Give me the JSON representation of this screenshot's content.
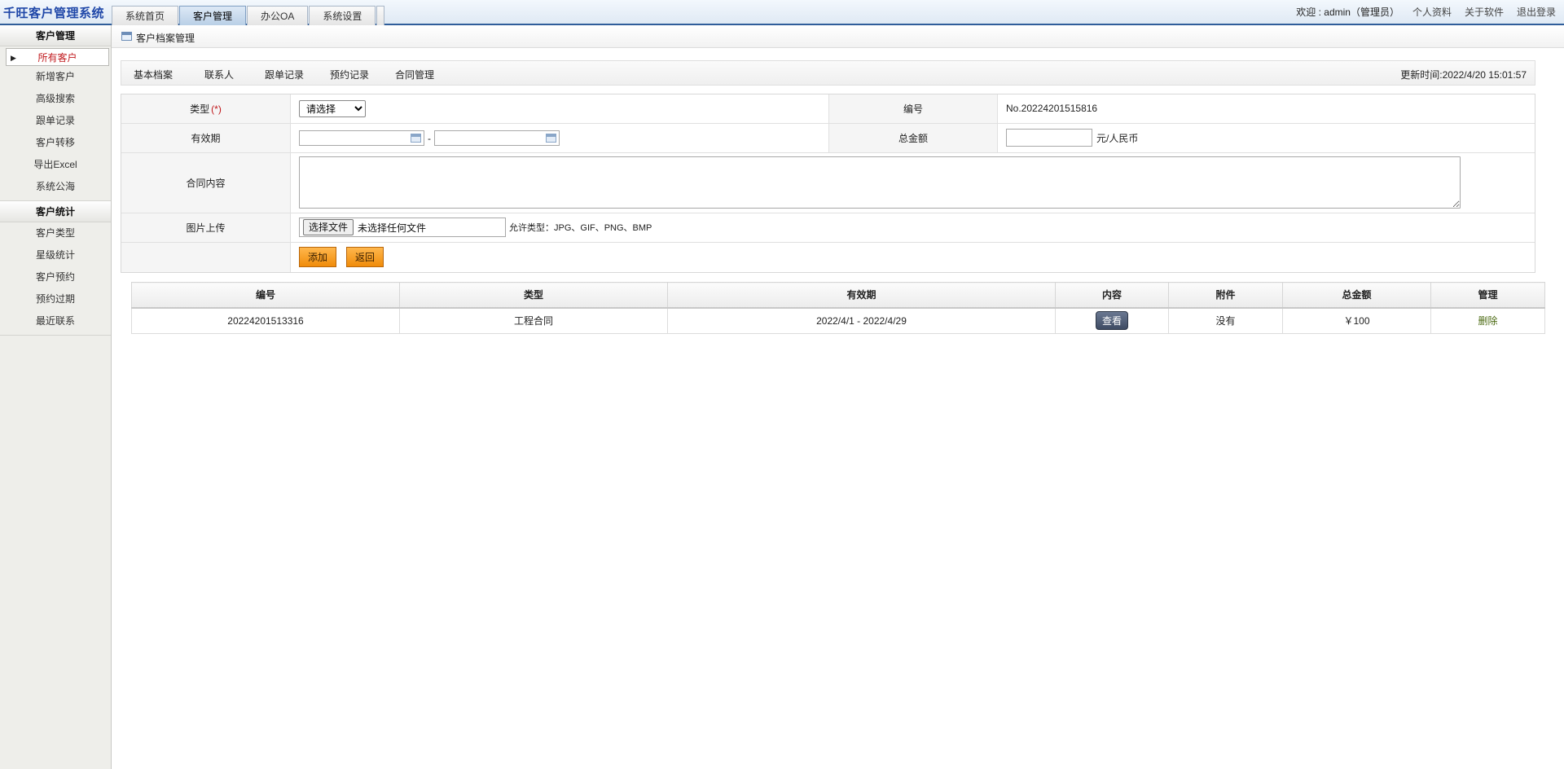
{
  "app": {
    "title": "千旺客户管理系统"
  },
  "nav_tabs": [
    "系统首页",
    "客户管理",
    "办公OA",
    "系统设置"
  ],
  "user": {
    "welcome": "欢迎 : admin（管理员）",
    "links": [
      "个人资料",
      "关于软件",
      "退出登录"
    ]
  },
  "sidebar": {
    "groups": [
      {
        "title": "客户管理",
        "items": [
          "所有客户",
          "新增客户",
          "高级搜索",
          "跟单记录",
          "客户转移",
          "导出Excel",
          "系统公海"
        ]
      },
      {
        "title": "客户统计",
        "items": [
          "客户类型",
          "星级统计",
          "客户预约",
          "预约过期",
          "最近联系"
        ]
      }
    ]
  },
  "page": {
    "title": "客户档案管理"
  },
  "subtabs": [
    "基本档案",
    "联系人",
    "跟单记录",
    "预约记录",
    "合同管理"
  ],
  "update_time": "更新时间:2022/4/20 15:01:57",
  "form": {
    "type_label": "类型",
    "required_mark": "(*)",
    "type_select": "请选择",
    "number_label": "编号",
    "number_value": "No.20224201515816",
    "validity_label": "有效期",
    "date_from": "",
    "date_to": "",
    "date_sep": "-",
    "total_label": "总金额",
    "total_value": "",
    "total_unit": "元/人民币",
    "content_label": "合同内容",
    "content_value": "",
    "upload_label": "图片上传",
    "upload_button": "选择文件",
    "upload_status": "未选择任何文件",
    "allowed_types": "允许类型：JPG、GIF、PNG、BMP",
    "add_button": "添加",
    "back_button": "返回"
  },
  "table": {
    "headers": [
      "编号",
      "类型",
      "有效期",
      "内容",
      "附件",
      "总金额",
      "管理"
    ],
    "rows": [
      {
        "number": "20224201513316",
        "type": "工程合同",
        "validity": "2022/4/1 - 2022/4/29",
        "content_button": "查看",
        "attachment": "没有",
        "total": "￥100",
        "action": "删除"
      }
    ]
  }
}
